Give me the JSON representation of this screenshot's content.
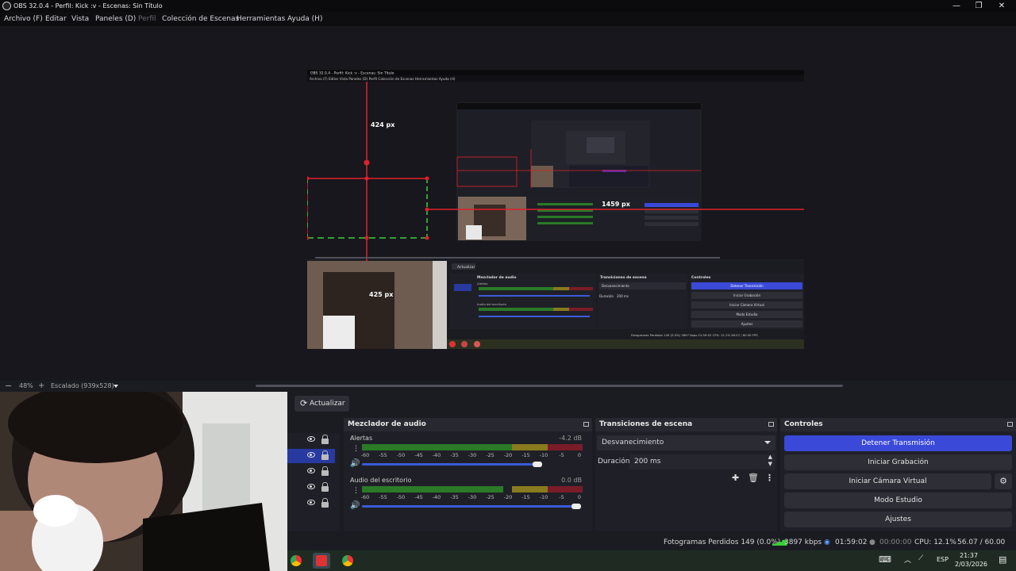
{
  "titlebar": {
    "title": "OBS 32.0.4 - Perfil: Kick :v - Escenas: Sin Título",
    "minimize": "—",
    "maximize": "❐",
    "close": "✕"
  },
  "menu": [
    "Archivo (F)",
    "Editar",
    "Vista",
    "Paneles (D)",
    "Perfil",
    "Colección de Escenas",
    "Herramientas",
    "Ayuda (H)"
  ],
  "preview": {
    "nested_title": "OBS 32.0.4 - Perfil: Kick :v - Escenas: Sin Título",
    "label_top": "424 px",
    "label_right": "1459 px",
    "label_bottom": "425 px",
    "nested_refresh": "Actualizar",
    "nested_audio": "Mezclador de audio",
    "nested_transitions": "Transiciones de escena",
    "nested_controls": "Controles",
    "nested_stop": "Detener Transmisión",
    "nested_record": "Iniciar Grabación",
    "nested_vcam": "Iniciar Cámara Virtual",
    "nested_studio": "Modo Estudio",
    "nested_settings": "Ajustes",
    "nested_fade": "Desvanecimiento",
    "nested_dur": "Duración",
    "nested_dur_val": "200 ms",
    "nested_status": "Fotogramas Perdidos 149 (0.0%)   3897 kbps   01:59:02   CPU: 12.1%   56.07 / 60.00 FPS",
    "nested_alerts": "Alertas",
    "nested_desktop": "Audio del escritorio"
  },
  "zoom": {
    "minus": "−",
    "value": "48%",
    "plus": "+",
    "scale": "Escalado (939x528)"
  },
  "refresh_label": "Actualizar",
  "audio": {
    "title": "Mezclador de audio",
    "channels": [
      {
        "name": "Alertas",
        "db": "-4.2 dB",
        "level": 0.88,
        "volume": 0.82
      },
      {
        "name": "Audio del escritorio",
        "db": "0.0 dB",
        "level": 0.64,
        "volume": 1.0
      }
    ],
    "ticks": [
      "-60",
      "-55",
      "-50",
      "-45",
      "-40",
      "-35",
      "-30",
      "-25",
      "-20",
      "-15",
      "-10",
      "-5",
      "0"
    ]
  },
  "transitions": {
    "title": "Transiciones de escena",
    "selected": "Desvanecimiento",
    "duration_label": "Duración",
    "duration_value": "200 ms"
  },
  "controls": {
    "title": "Controles",
    "buttons": [
      "Detener Transmisión",
      "Iniciar Grabación",
      "Iniciar Cámara Virtual",
      "Modo Estudio",
      "Ajustes"
    ]
  },
  "status": {
    "dropped": "Fotogramas Perdidos 149 (0.0%)",
    "bitrate": "3897 kbps",
    "stream_time": "01:59:02",
    "rec_time": "00:00:00",
    "cpu": "CPU: 12.1%",
    "fps": "56.07 / 60.00 FPS"
  },
  "taskbar": {
    "lang": "ESP",
    "time": "21:37",
    "date": "2/03/2026"
  },
  "colors": {
    "accent": "#3a49d8",
    "guide": "#e0202a",
    "guide_dash": "#3ad13a"
  }
}
